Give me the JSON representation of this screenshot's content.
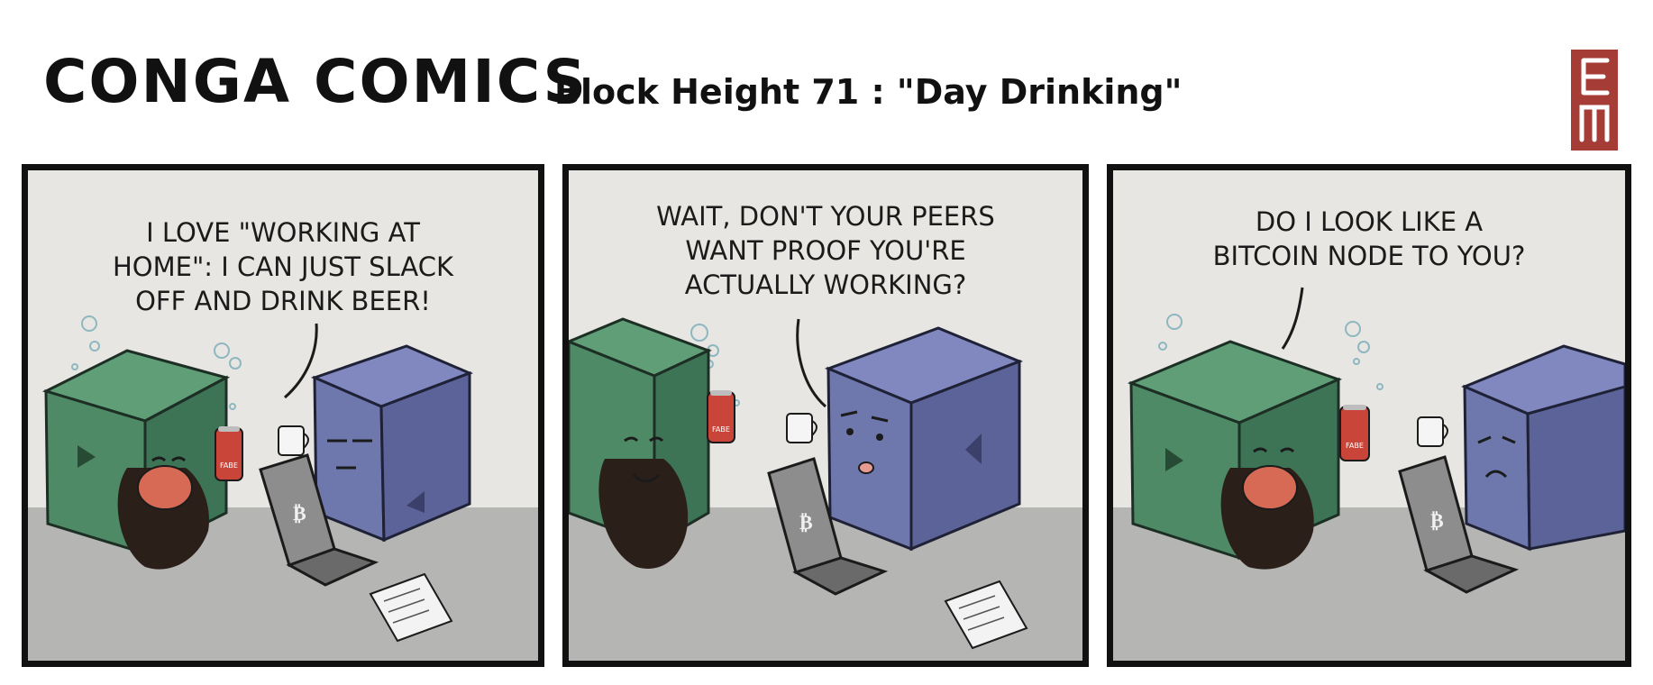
{
  "comic": {
    "title": "CONGA COMICS",
    "subtitle": "Block Height 71 : \"Day Drinking\"",
    "logo_text": "EM"
  },
  "panels": [
    {
      "speech": "I LOVE \"WORKING AT\nHOME\": I CAN JUST SLACK\nOFF AND DRINK BEER!",
      "can_label": "FABE"
    },
    {
      "speech": "WAIT, DON'T YOUR PEERS\nWANT PROOF YOU'RE\nACTUALLY WORKING?",
      "can_label": "FABE"
    },
    {
      "speech": "DO I LOOK LIKE A\nBITCOIN NODE TO YOU?",
      "can_label": "FABE"
    }
  ],
  "colors": {
    "green_block": "#4f8a66",
    "blue_block": "#6f78ad",
    "panel_bg": "#e7e6e2",
    "floor": "#b5b5b3",
    "logo": "#a53d36",
    "can": "#c9453a"
  },
  "icons": [
    "bitcoin-icon",
    "coffee-mug-icon",
    "beer-can-icon",
    "laptop-icon"
  ]
}
